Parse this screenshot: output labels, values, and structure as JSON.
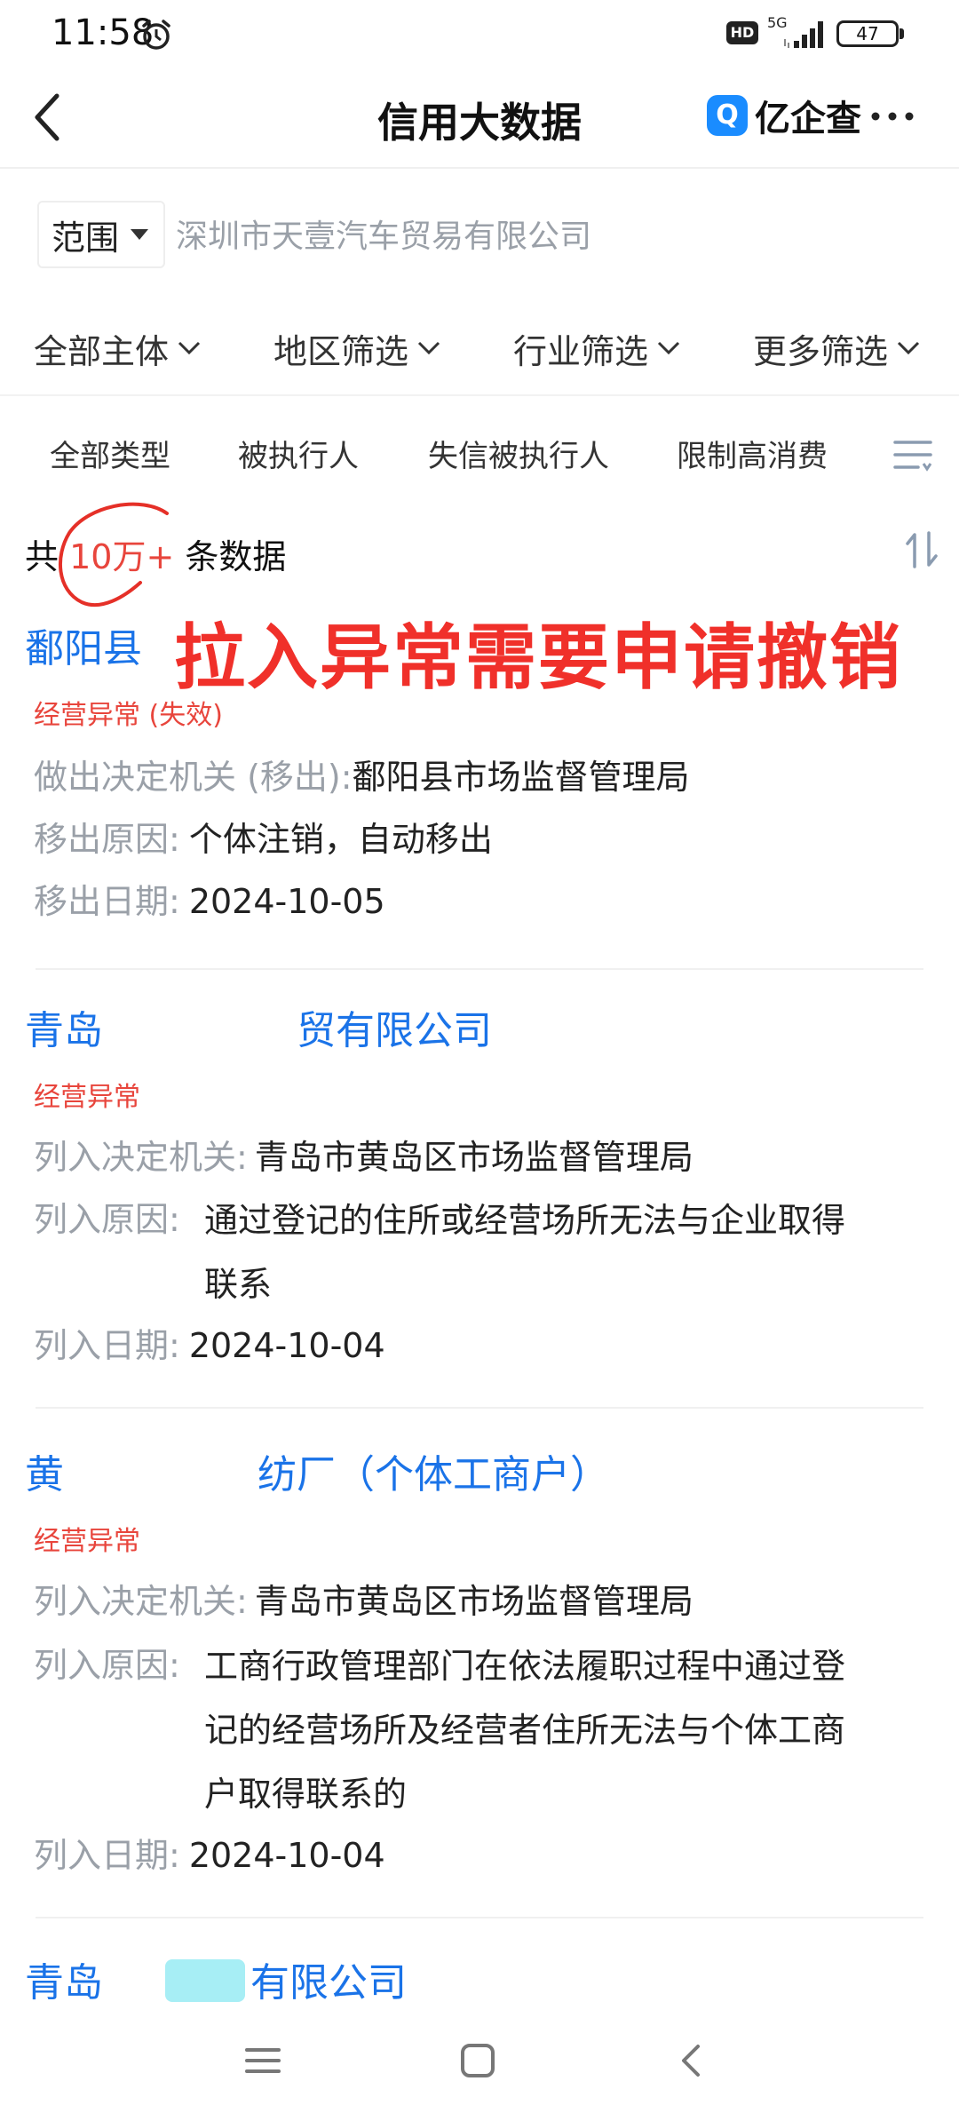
{
  "status_bar": {
    "time": "11:58",
    "hd_label": "HD",
    "network": "5G",
    "battery": "47"
  },
  "header": {
    "title": "信用大数据",
    "brand_logo": "Q",
    "brand_name": "亿企查"
  },
  "search": {
    "scope_label": "范围",
    "placeholder": "深圳市天壹汽车贸易有限公司"
  },
  "filters": [
    "全部主体",
    "地区筛选",
    "行业筛选",
    "更多筛选"
  ],
  "tabs": [
    "全部类型",
    "被执行人",
    "失信被执行人",
    "限制高消费"
  ],
  "summary": {
    "prefix": "共",
    "count": "10万+",
    "suffix": "条数据"
  },
  "overlay_annotation": "拉入异常需要申请撤销",
  "records": [
    {
      "name_visible": "鄱阳县",
      "tag": "经营异常 (失效)",
      "fields": [
        {
          "key": "做出决定机关 (移出):",
          "value": "鄱阳县市场监督管理局"
        },
        {
          "key": "移出原因:",
          "value": "个体注销，自动移出"
        },
        {
          "key": "移出日期:",
          "value": "2024-10-05"
        }
      ]
    },
    {
      "name_left": "青岛",
      "name_right": "贸有限公司",
      "tag": "经营异常",
      "fields": [
        {
          "key": "列入决定机关:",
          "value": "青岛市黄岛区市场监督管理局"
        },
        {
          "key": "列入原因:",
          "value_lines": [
            "通过登记的住所或经营场所无法与企业取得",
            "联系"
          ]
        },
        {
          "key": "列入日期:",
          "value": "2024-10-04"
        }
      ]
    },
    {
      "name_left": "黄",
      "name_right": "纺厂（个体工商户）",
      "tag": "经营异常",
      "fields": [
        {
          "key": "列入决定机关:",
          "value": "青岛市黄岛区市场监督管理局"
        },
        {
          "key": "列入原因:",
          "value_lines": [
            "工商行政管理部门在依法履职过程中通过登",
            "记的经营场所及经营者住所无法与个体工商",
            "户取得联系的"
          ]
        },
        {
          "key": "列入日期:",
          "value": "2024-10-04"
        }
      ]
    },
    {
      "name_left": "青岛",
      "name_right": "有限公司"
    }
  ],
  "colors": {
    "link_blue": "#1a73e8",
    "alert_red": "#e8453c",
    "overlay_red": "#f0302a",
    "label_gray": "#9aa0a8"
  }
}
